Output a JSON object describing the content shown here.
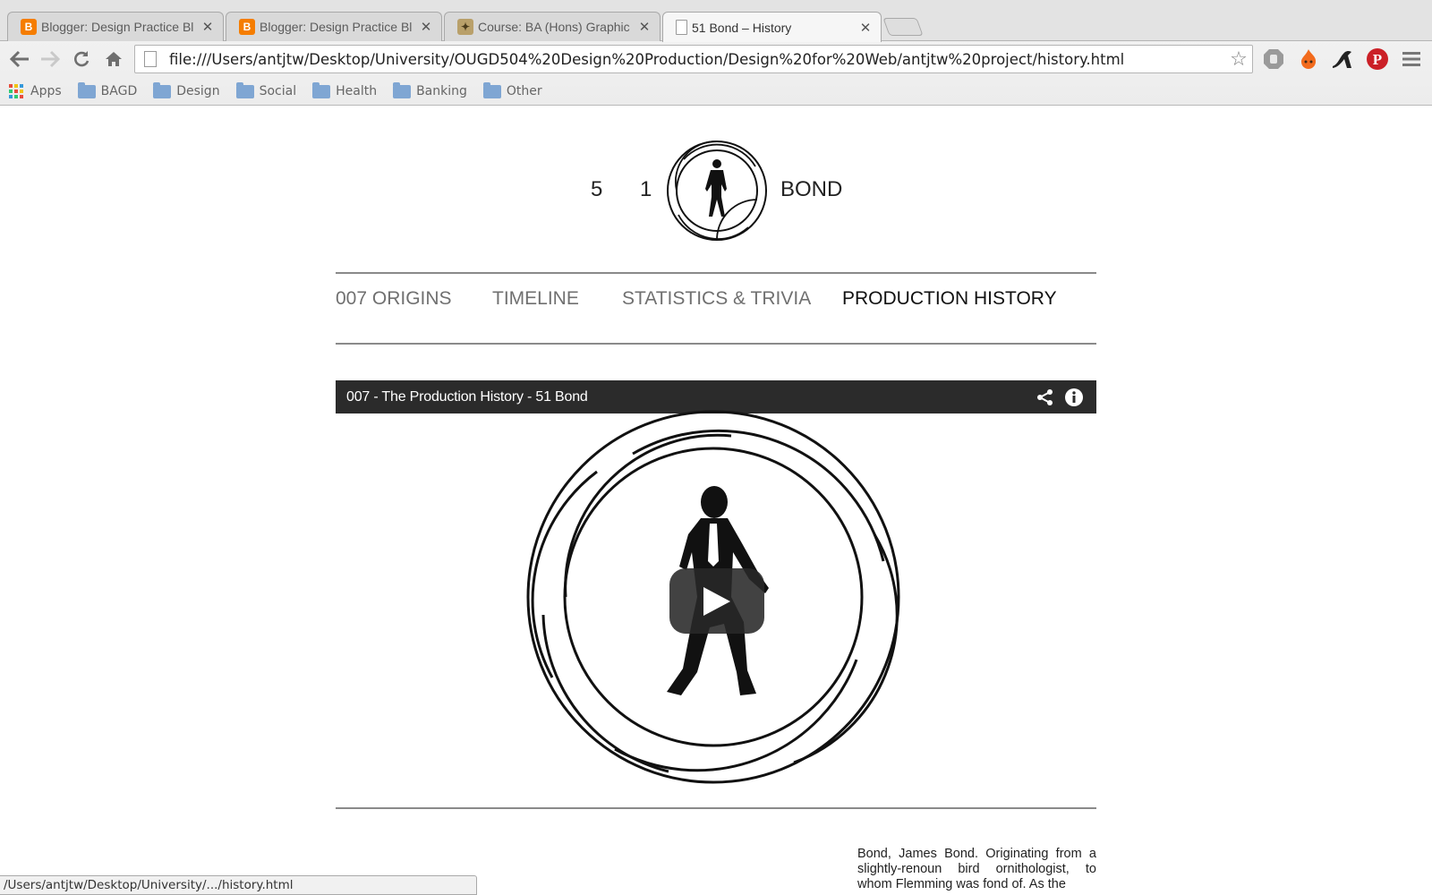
{
  "browser": {
    "tabs": [
      {
        "title": "Blogger: Design Practice Bl",
        "favicon": "blogger-icon",
        "active": false
      },
      {
        "title": "Blogger: Design Practice Bl",
        "favicon": "blogger-icon",
        "active": false
      },
      {
        "title": "Course: BA (Hons) Graphic",
        "favicon": "course-icon",
        "active": false
      },
      {
        "title": "51 Bond – History",
        "favicon": "page-icon",
        "active": true
      }
    ],
    "url": "file:///Users/antjtw/Desktop/University/OUGD504%20Design%20Production/Design%20for%20Web/antjtw%20project/history.html",
    "bookmarks": {
      "apps_label": "Apps",
      "folders": [
        "BAGD",
        "Design",
        "Social",
        "Health",
        "Banking",
        "Other"
      ]
    },
    "status_text": "/Users/antjtw/Desktop/University/.../history.html"
  },
  "site": {
    "logo": {
      "char1": "5",
      "char2": "1",
      "wordmark": "BOND"
    },
    "nav": [
      {
        "label": "007 ORIGINS",
        "current": false
      },
      {
        "label": "TIMELINE",
        "current": false
      },
      {
        "label": "STATISTICS & TRIVIA",
        "current": false
      },
      {
        "label": "PRODUCTION HISTORY",
        "current": true
      }
    ],
    "video": {
      "title": "007 - The Production History - 51 Bond"
    },
    "body_text": "Bond, James Bond. Originating from a slightly-renoun bird ornithologist, to whom Flemming was fond of. As the"
  },
  "colors": {
    "video_bar": "#2b2b2b",
    "rule": "#8a8a8a",
    "nav_current": "#111111",
    "nav_default": "#707070"
  }
}
